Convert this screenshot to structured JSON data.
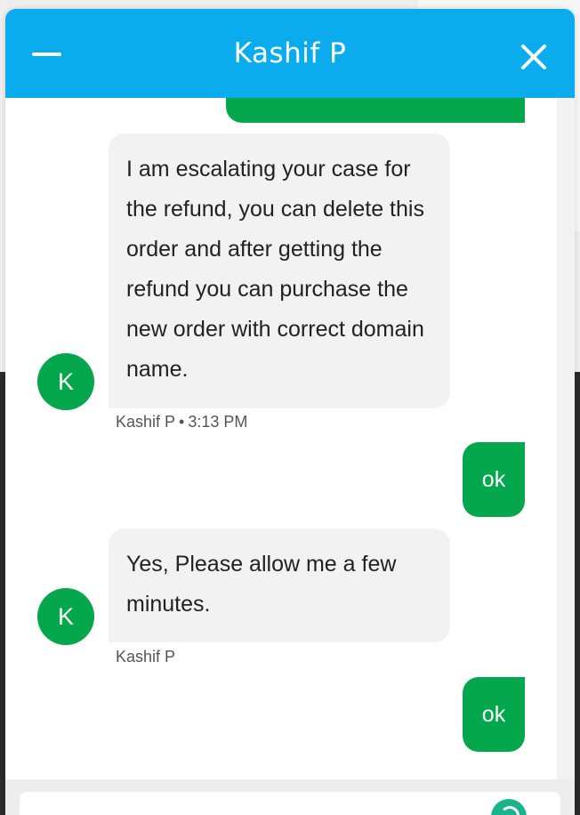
{
  "header": {
    "title": "Kashif P"
  },
  "messages": [
    {
      "from": "agent",
      "avatar_letter": "K",
      "text": "I am escalating your case for the refund, you can delete this order and after getting the refund you can purchase the new order with correct domain name.",
      "sender": "Kashif P",
      "time": "3:13 PM"
    },
    {
      "from": "user",
      "text": "ok"
    },
    {
      "from": "agent",
      "avatar_letter": "K",
      "text": "Yes, Please allow me a few minutes.",
      "sender": "Kashif P"
    },
    {
      "from": "user",
      "text": "ok"
    }
  ],
  "colors": {
    "header": "#0aaced",
    "accent_green": "#05a74c",
    "agent_bubble": "#f2f2f2"
  },
  "icons": {
    "minimize": "minimize-icon",
    "close": "close-icon",
    "send": "send-icon"
  }
}
